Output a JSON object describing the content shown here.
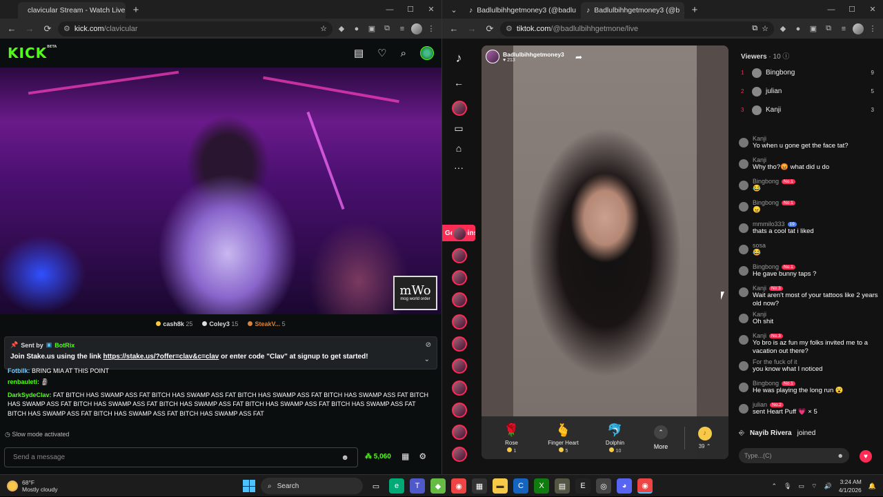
{
  "left_browser": {
    "tab_title": "clavicular Stream - Watch Live o",
    "url_domain": "kick.com",
    "url_path": "/clavicular"
  },
  "kick": {
    "logo": "KICK",
    "logo_sup": "BETA",
    "watermark": "mWo",
    "watermark_sub": "mog world order",
    "gifters": [
      {
        "name": "cash8k",
        "count": "25"
      },
      {
        "name": "Coley3",
        "count": "15"
      },
      {
        "name": "SteakV...",
        "count": "5"
      }
    ],
    "pinned": {
      "sent_by": "Sent by",
      "bot": "BotRix",
      "text_before": "Join Stake.us using the link ",
      "link": "https://stake.us/?offer=clav&c=clav",
      "text_after": " or enter code \"Clav\" at signup to get started!"
    },
    "chat": [
      {
        "user": "Fotbilk:",
        "text": " BRING MIA AT THIS POINT"
      },
      {
        "user": "renbauleti:",
        "text": ""
      },
      {
        "user": "DarkSydeClav:",
        "text": " FAT BITCH HAS SWAMP ASS FAT BITCH HAS SWAMP ASS FAT BITCH HAS SWAMP ASS FAT BITCH HAS SWAMP ASS FAT BITCH HAS SWAMP ASS FAT BITCH HAS SWAMP ASS FAT BITCH HAS SWAMP ASS FAT BITCH HAS SWAMP ASS FAT BITCH HAS SWAMP ASS FAT BITCH HAS SWAMP ASS FAT BITCH HAS SWAMP ASS FAT BITCH HAS SWAMP ASS FAT"
      }
    ],
    "slow_mode": "Slow mode activated",
    "send_placeholder": "Send a message",
    "points": "5,060"
  },
  "right_browser": {
    "tab1_title": "Badlulbihhgetmoney3 (@badlu",
    "tab2_title": "Badlulbihhgetmoney3 (@b",
    "url_domain": "tiktok.com",
    "url_path": "/@badlulbihhgetmone/live"
  },
  "tiktok": {
    "get_coins": "Get Coins",
    "host_name": "Badlulbihhgetmoney3",
    "host_likes": "213",
    "gifts": [
      {
        "name": "Rose",
        "price": "1"
      },
      {
        "name": "Finger Heart",
        "price": "5"
      },
      {
        "name": "Dolphin",
        "price": "10"
      }
    ],
    "more_label": "More",
    "coins": "39",
    "viewers_label": "Viewers",
    "viewers_count": "· 10",
    "top_viewers": [
      {
        "rank": "1",
        "name": "Bingbong",
        "score": "9"
      },
      {
        "rank": "2",
        "name": "julian",
        "score": "5"
      },
      {
        "rank": "3",
        "name": "Kanji",
        "score": "3"
      }
    ],
    "comments": [
      {
        "user": "Kanji",
        "badge": "",
        "text": "Yo when u gone get the face tat?"
      },
      {
        "user": "Kanji",
        "badge": "",
        "text": "Why tho?😡 what did u do"
      },
      {
        "user": "Bingbong",
        "badge": "No.1",
        "text": "😂"
      },
      {
        "user": "Bingbong",
        "badge": "No.1",
        "text": "😠"
      },
      {
        "user": "mmmilo333",
        "badge": "19",
        "text": "thats a cool tat i liked"
      },
      {
        "user": "sosa",
        "badge": "",
        "text": "😂"
      },
      {
        "user": "Bingbong",
        "badge": "No.1",
        "text": "He gave bunny taps ?"
      },
      {
        "user": "Kanji",
        "badge": "No.3",
        "text": "Wait aren't most of your tattoos like 2 years old now?"
      },
      {
        "user": "Kanji",
        "badge": "",
        "text": "Oh shit"
      },
      {
        "user": "Kanji",
        "badge": "No.3",
        "text": "Yo bro is az fun my folks invited me to a vacation out there?"
      },
      {
        "user": "For the fuck of it",
        "badge": "",
        "text": "you know what I noticed"
      },
      {
        "user": "Bingbong",
        "badge": "No.1",
        "text": "He was playing the long run 😮"
      },
      {
        "user": "julian",
        "badge": "No.2",
        "text": "sent Heart Puff 💗 × 5"
      }
    ],
    "joined_user": "Nayib Rivera",
    "joined_text": "joined",
    "type_placeholder": "Type...(C)"
  },
  "taskbar": {
    "temp": "68°F",
    "weather": "Mostly cloudy",
    "search": "Search",
    "time": "3:24 AM",
    "date": "4/1/2026"
  }
}
